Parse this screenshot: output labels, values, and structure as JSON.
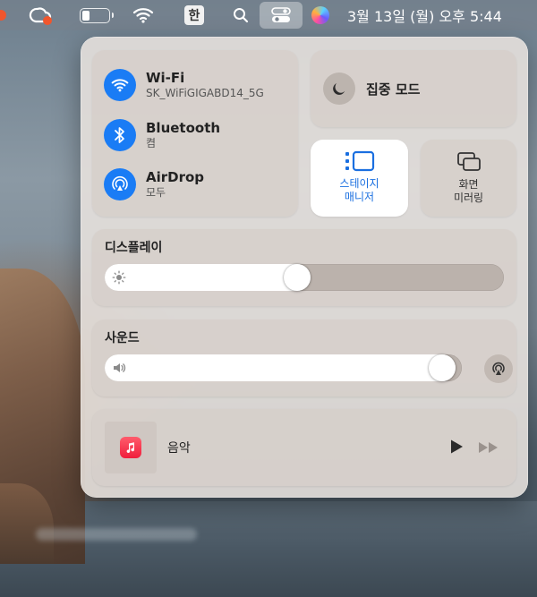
{
  "menubar": {
    "ime_label": "한",
    "clock": "3월 13일 (월) 오후 5:44",
    "battery_level": 0.3,
    "icons": [
      "notification-dot-icon",
      "creative-cloud-icon",
      "battery-icon",
      "wifi-icon",
      "search-icon",
      "control-center-icon",
      "siri-icon"
    ]
  },
  "control_center": {
    "network": {
      "wifi": {
        "title": "Wi-Fi",
        "subtitle": "SK_WiFiGIGABD14_5G"
      },
      "bluetooth": {
        "title": "Bluetooth",
        "subtitle": "켬"
      },
      "airdrop": {
        "title": "AirDrop",
        "subtitle": "모두"
      }
    },
    "focus": {
      "label": "집중 모드"
    },
    "stage_manager": {
      "line1": "스테이지",
      "line2": "매니저",
      "active": true
    },
    "screen_mirroring": {
      "line1": "화면",
      "line2": "미러링"
    },
    "display": {
      "title": "디스플레이",
      "brightness": 0.48
    },
    "sound": {
      "title": "사운드",
      "volume": 0.98
    },
    "now_playing": {
      "title": "음악"
    },
    "colors": {
      "accent": "#1a7cf5",
      "stage_text": "#1a6fe0"
    }
  }
}
